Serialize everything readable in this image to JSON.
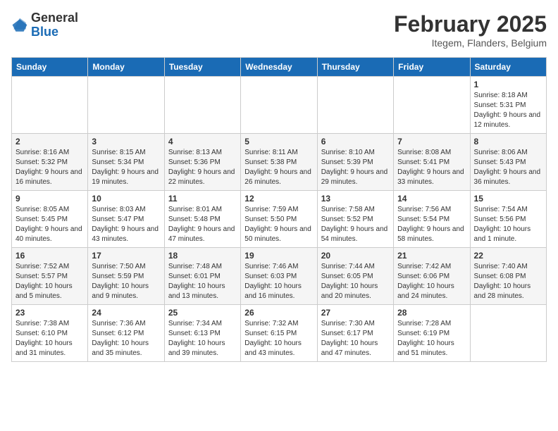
{
  "logo": {
    "general": "General",
    "blue": "Blue"
  },
  "title": "February 2025",
  "subtitle": "Itegem, Flanders, Belgium",
  "days_of_week": [
    "Sunday",
    "Monday",
    "Tuesday",
    "Wednesday",
    "Thursday",
    "Friday",
    "Saturday"
  ],
  "weeks": [
    [
      {
        "day": "",
        "info": ""
      },
      {
        "day": "",
        "info": ""
      },
      {
        "day": "",
        "info": ""
      },
      {
        "day": "",
        "info": ""
      },
      {
        "day": "",
        "info": ""
      },
      {
        "day": "",
        "info": ""
      },
      {
        "day": "1",
        "info": "Sunrise: 8:18 AM\nSunset: 5:31 PM\nDaylight: 9 hours and 12 minutes."
      }
    ],
    [
      {
        "day": "2",
        "info": "Sunrise: 8:16 AM\nSunset: 5:32 PM\nDaylight: 9 hours and 16 minutes."
      },
      {
        "day": "3",
        "info": "Sunrise: 8:15 AM\nSunset: 5:34 PM\nDaylight: 9 hours and 19 minutes."
      },
      {
        "day": "4",
        "info": "Sunrise: 8:13 AM\nSunset: 5:36 PM\nDaylight: 9 hours and 22 minutes."
      },
      {
        "day": "5",
        "info": "Sunrise: 8:11 AM\nSunset: 5:38 PM\nDaylight: 9 hours and 26 minutes."
      },
      {
        "day": "6",
        "info": "Sunrise: 8:10 AM\nSunset: 5:39 PM\nDaylight: 9 hours and 29 minutes."
      },
      {
        "day": "7",
        "info": "Sunrise: 8:08 AM\nSunset: 5:41 PM\nDaylight: 9 hours and 33 minutes."
      },
      {
        "day": "8",
        "info": "Sunrise: 8:06 AM\nSunset: 5:43 PM\nDaylight: 9 hours and 36 minutes."
      }
    ],
    [
      {
        "day": "9",
        "info": "Sunrise: 8:05 AM\nSunset: 5:45 PM\nDaylight: 9 hours and 40 minutes."
      },
      {
        "day": "10",
        "info": "Sunrise: 8:03 AM\nSunset: 5:47 PM\nDaylight: 9 hours and 43 minutes."
      },
      {
        "day": "11",
        "info": "Sunrise: 8:01 AM\nSunset: 5:48 PM\nDaylight: 9 hours and 47 minutes."
      },
      {
        "day": "12",
        "info": "Sunrise: 7:59 AM\nSunset: 5:50 PM\nDaylight: 9 hours and 50 minutes."
      },
      {
        "day": "13",
        "info": "Sunrise: 7:58 AM\nSunset: 5:52 PM\nDaylight: 9 hours and 54 minutes."
      },
      {
        "day": "14",
        "info": "Sunrise: 7:56 AM\nSunset: 5:54 PM\nDaylight: 9 hours and 58 minutes."
      },
      {
        "day": "15",
        "info": "Sunrise: 7:54 AM\nSunset: 5:56 PM\nDaylight: 10 hours and 1 minute."
      }
    ],
    [
      {
        "day": "16",
        "info": "Sunrise: 7:52 AM\nSunset: 5:57 PM\nDaylight: 10 hours and 5 minutes."
      },
      {
        "day": "17",
        "info": "Sunrise: 7:50 AM\nSunset: 5:59 PM\nDaylight: 10 hours and 9 minutes."
      },
      {
        "day": "18",
        "info": "Sunrise: 7:48 AM\nSunset: 6:01 PM\nDaylight: 10 hours and 13 minutes."
      },
      {
        "day": "19",
        "info": "Sunrise: 7:46 AM\nSunset: 6:03 PM\nDaylight: 10 hours and 16 minutes."
      },
      {
        "day": "20",
        "info": "Sunrise: 7:44 AM\nSunset: 6:05 PM\nDaylight: 10 hours and 20 minutes."
      },
      {
        "day": "21",
        "info": "Sunrise: 7:42 AM\nSunset: 6:06 PM\nDaylight: 10 hours and 24 minutes."
      },
      {
        "day": "22",
        "info": "Sunrise: 7:40 AM\nSunset: 6:08 PM\nDaylight: 10 hours and 28 minutes."
      }
    ],
    [
      {
        "day": "23",
        "info": "Sunrise: 7:38 AM\nSunset: 6:10 PM\nDaylight: 10 hours and 31 minutes."
      },
      {
        "day": "24",
        "info": "Sunrise: 7:36 AM\nSunset: 6:12 PM\nDaylight: 10 hours and 35 minutes."
      },
      {
        "day": "25",
        "info": "Sunrise: 7:34 AM\nSunset: 6:13 PM\nDaylight: 10 hours and 39 minutes."
      },
      {
        "day": "26",
        "info": "Sunrise: 7:32 AM\nSunset: 6:15 PM\nDaylight: 10 hours and 43 minutes."
      },
      {
        "day": "27",
        "info": "Sunrise: 7:30 AM\nSunset: 6:17 PM\nDaylight: 10 hours and 47 minutes."
      },
      {
        "day": "28",
        "info": "Sunrise: 7:28 AM\nSunset: 6:19 PM\nDaylight: 10 hours and 51 minutes."
      },
      {
        "day": "",
        "info": ""
      }
    ]
  ]
}
